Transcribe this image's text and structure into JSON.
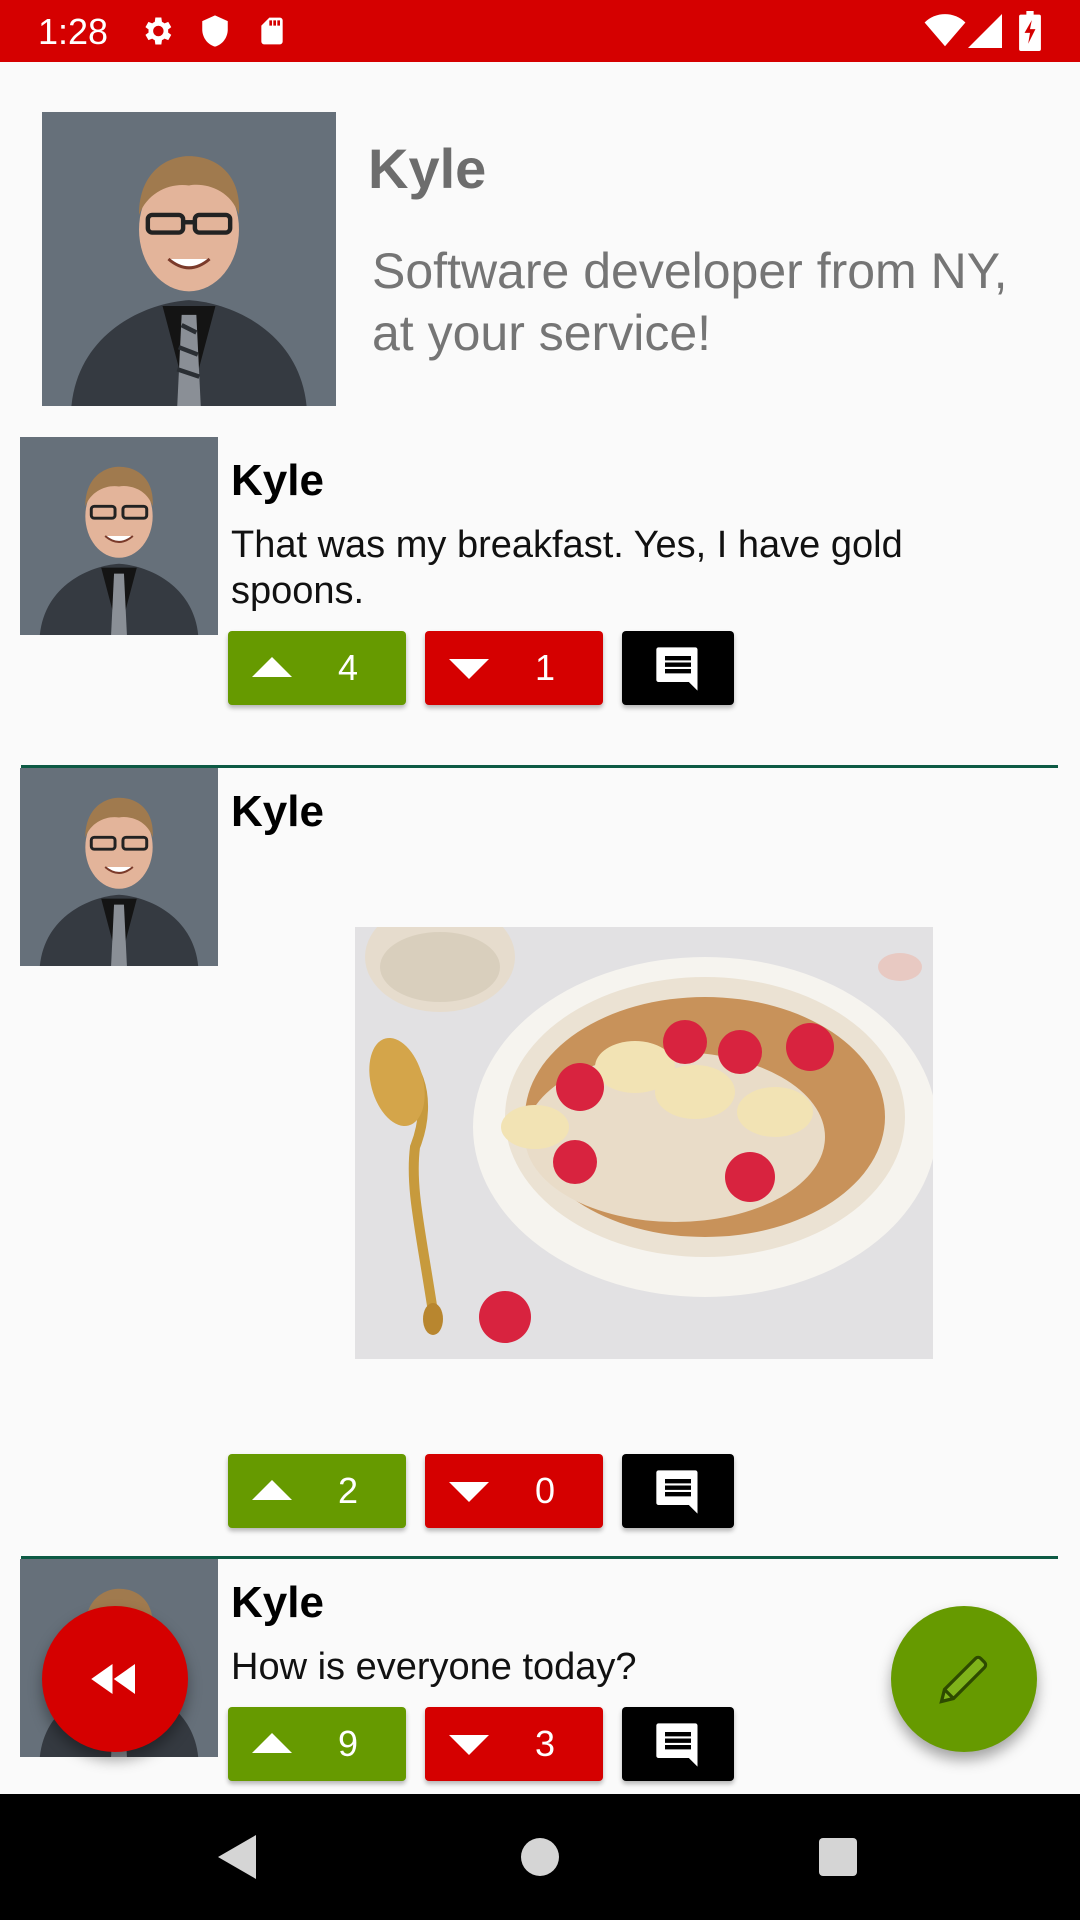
{
  "status_bar": {
    "time": "1:28",
    "left_icons": [
      "gear-icon",
      "shield-icon",
      "sd-card-icon"
    ],
    "right_icons": [
      "wifi-icon",
      "cell-signal-icon",
      "battery-charging-icon"
    ]
  },
  "profile": {
    "name": "Kyle",
    "bio": "Software developer from NY, at your service!"
  },
  "posts": [
    {
      "author": "Kyle",
      "text": "That was my breakfast. Yes, I have gold spoons.",
      "upvotes": "4",
      "downvotes": "1"
    },
    {
      "author": "Kyle",
      "image": "oatmeal-bowl-with-raspberries-bananas-and-gold-spoon",
      "upvotes": "2",
      "downvotes": "0"
    },
    {
      "author": "Kyle",
      "text": "How is everyone today?",
      "upvotes": "9",
      "downvotes": "3"
    }
  ],
  "fabs": {
    "left": "rewind-icon",
    "right": "pencil-icon"
  },
  "navigation": [
    "back-icon",
    "home-icon",
    "recents-icon"
  ],
  "colors": {
    "primary_red": "#d50000",
    "upvote_green": "#669a00",
    "divider": "#0d5a44",
    "comment_black": "#000000"
  }
}
